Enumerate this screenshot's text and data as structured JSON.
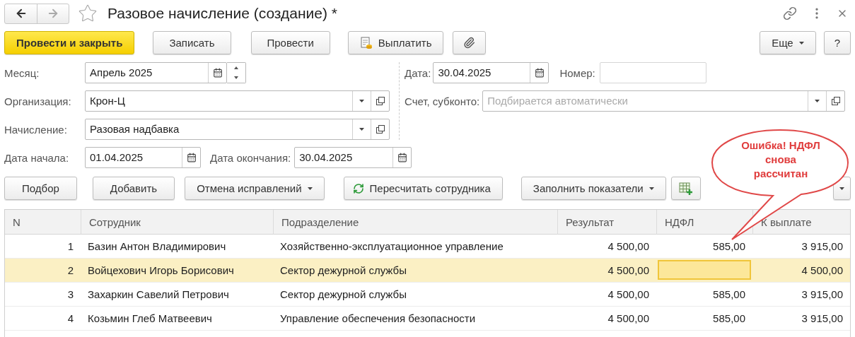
{
  "window": {
    "title": "Разовое начисление (создание) *"
  },
  "toolbar": {
    "buttons": [
      {
        "label": "Провести и закрыть",
        "kind": "primary"
      },
      {
        "label": "Записать",
        "kind": "plain"
      },
      {
        "label": "Провести",
        "kind": "plain"
      },
      {
        "label": "Выплатить",
        "kind": "pay"
      },
      {
        "kind": "attach"
      }
    ],
    "right_buttons": [
      {
        "label": "Еще",
        "kind": "menu"
      },
      {
        "label": "?",
        "kind": "plain"
      }
    ]
  },
  "form": {
    "month": {
      "label": "Месяц:",
      "value": "Апрель 2025"
    },
    "organization": {
      "label": "Организация:",
      "value": "Крон-Ц"
    },
    "accrual": {
      "label": "Начисление:",
      "value": "Разовая надбавка"
    },
    "date": {
      "label": "Дата:",
      "value": "30.04.2025"
    },
    "number": {
      "label": "Номер:"
    },
    "account": {
      "label": "Счет, субконто:",
      "placeholder": "Подбирается автоматически"
    },
    "start_date": {
      "label": "Дата начала:",
      "value": "01.04.2025"
    },
    "end_date": {
      "label": "Дата окончания:",
      "value": "30.04.2025"
    }
  },
  "table_toolbar": {
    "buttons": [
      {
        "label": "Подбор",
        "kind": "plain"
      },
      {
        "label": "Добавить",
        "kind": "plain"
      },
      {
        "label": "Отмена исправлений",
        "kind": "menu"
      },
      {
        "label": "Пересчитать сотрудника",
        "kind": "refresh"
      },
      {
        "label": "Заполнить показатели",
        "kind": "menu"
      },
      {
        "kind": "table-add"
      }
    ]
  },
  "table": {
    "columns": [
      "N",
      "Сотрудник",
      "Подразделение",
      "Результат",
      "НДФЛ",
      "К выплате"
    ],
    "rows": [
      {
        "selected": false,
        "cells": [
          {
            "text": "1",
            "focused": false
          },
          {
            "text": "Базин Антон Владимирович",
            "focused": false
          },
          {
            "text": "Хозяйственно-эксплуатационное управление",
            "focused": false
          },
          {
            "text": "4 500,00",
            "focused": false
          },
          {
            "text": "585,00",
            "focused": false
          },
          {
            "text": "3 915,00",
            "focused": false
          }
        ]
      },
      {
        "selected": true,
        "cells": [
          {
            "text": "2",
            "focused": false
          },
          {
            "text": "Войцехович Игорь Борисович",
            "focused": false
          },
          {
            "text": "Сектор дежурной службы",
            "focused": false
          },
          {
            "text": "4 500,00",
            "focused": false
          },
          {
            "focused": true
          },
          {
            "text": "4 500,00",
            "focused": false
          }
        ]
      },
      {
        "selected": false,
        "cells": [
          {
            "text": "3",
            "focused": false
          },
          {
            "text": "Захаркин Савелий Петрович",
            "focused": false
          },
          {
            "text": "Сектор дежурной службы",
            "focused": false
          },
          {
            "text": "4 500,00",
            "focused": false
          },
          {
            "text": "585,00",
            "focused": false
          },
          {
            "text": "3 915,00",
            "focused": false
          }
        ]
      },
      {
        "selected": false,
        "cells": [
          {
            "text": "4",
            "focused": false
          },
          {
            "text": "Козьмин Глеб Матвеевич",
            "focused": false
          },
          {
            "text": "Управление обеспечения безопасности",
            "focused": false
          },
          {
            "text": "4 500,00",
            "focused": false
          },
          {
            "text": "585,00",
            "focused": false
          },
          {
            "text": "3 915,00",
            "focused": false
          }
        ]
      }
    ]
  },
  "callout": {
    "text": "Ошибка! НДФЛ снова рассчитан"
  }
}
